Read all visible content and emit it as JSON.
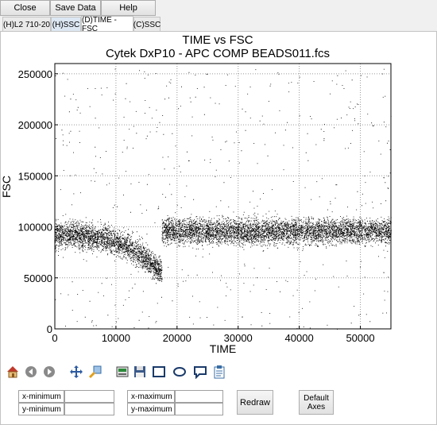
{
  "toolbar_top": {
    "close_label": "Close",
    "save_label": "Save Data",
    "help_label": "Help"
  },
  "tabs": [
    {
      "label": "(H)L2 710-20"
    },
    {
      "label": "(H)SSC"
    },
    {
      "label": "(D)TIME - FSC"
    },
    {
      "label": "(C)SSC"
    }
  ],
  "chart_data": {
    "type": "scatter",
    "title": "TIME vs FSC",
    "subtitle": "Cytek DxP10 - APC COMP BEADS011.fcs",
    "xlabel": "TIME",
    "ylabel": "FSC",
    "xlim": [
      0,
      55000
    ],
    "ylim": [
      0,
      260000
    ],
    "xticks": [
      "0",
      "10000",
      "20000",
      "30000",
      "40000",
      "50000"
    ],
    "yticks": [
      "0",
      "50000",
      "100000",
      "150000",
      "200000",
      "250000"
    ],
    "grid": true,
    "point_color": "#000000",
    "segments": [
      {
        "x_range": [
          0,
          17500
        ],
        "y_start": 92000,
        "y_end": 55000,
        "spread": 12000
      },
      {
        "x_range": [
          17500,
          55000
        ],
        "y_center": 96000,
        "spread": 12000
      }
    ],
    "outlier_y_range": [
      0,
      255000
    ]
  },
  "nav_icons": [
    "home-icon",
    "back-icon",
    "forward-icon",
    "pan-icon",
    "zoom-icon",
    "configure-icon",
    "save-icon",
    "rectangle-gate-icon",
    "ellipse-gate-icon",
    "polygon-gate-icon",
    "clipboard-icon"
  ],
  "axes_form": {
    "xmin_label": "x-minimum",
    "ymin_label": "y-minimum",
    "xmax_label": "x-maximum",
    "ymax_label": "y-maximum",
    "xmin_value": "",
    "ymin_value": "",
    "xmax_value": "",
    "ymax_value": "",
    "redraw_label": "Redraw",
    "default_axes_label_1": "Default",
    "default_axes_label_2": "Axes"
  }
}
